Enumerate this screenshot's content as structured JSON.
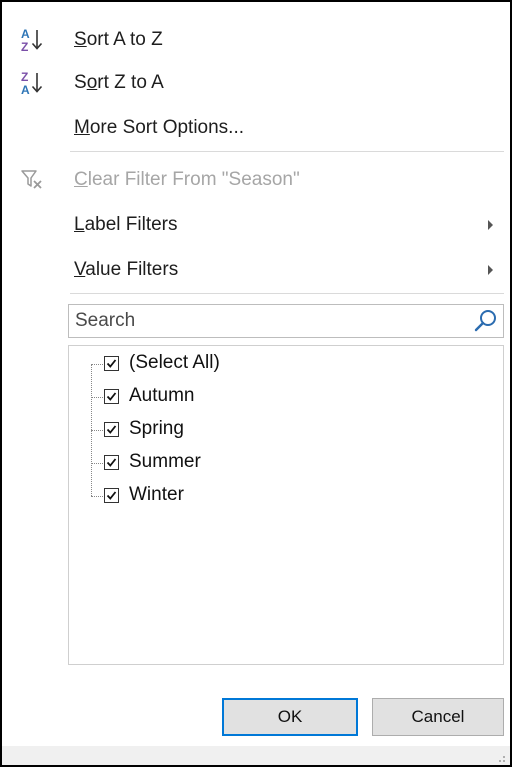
{
  "menu": {
    "sort_a_z": {
      "pre": "",
      "underline": "S",
      "post": "ort A to Z"
    },
    "sort_z_a": {
      "pre": "S",
      "underline": "o",
      "post": "rt Z to A"
    },
    "more_sort": {
      "pre": "",
      "underline": "M",
      "post": "ore Sort Options..."
    },
    "clear_filter": {
      "pre": "",
      "underline": "C",
      "post": "lear Filter From \"Season\""
    },
    "label_filters": {
      "pre": "",
      "underline": "L",
      "post": "abel Filters"
    },
    "value_filters": {
      "pre": "",
      "underline": "V",
      "post": "alue Filters"
    }
  },
  "search": {
    "placeholder": "Search"
  },
  "list": {
    "items": [
      {
        "label": "(Select All)",
        "checked": true
      },
      {
        "label": "Autumn",
        "checked": true
      },
      {
        "label": "Spring",
        "checked": true
      },
      {
        "label": "Summer",
        "checked": true
      },
      {
        "label": "Winter",
        "checked": true
      }
    ]
  },
  "buttons": {
    "ok": "OK",
    "cancel": "Cancel"
  },
  "colors": {
    "sort_icon_blue": "#2e75b6",
    "sort_icon_purple": "#7a4fa8",
    "ok_border": "#0078d7",
    "disabled_text": "#a6a6a6"
  }
}
